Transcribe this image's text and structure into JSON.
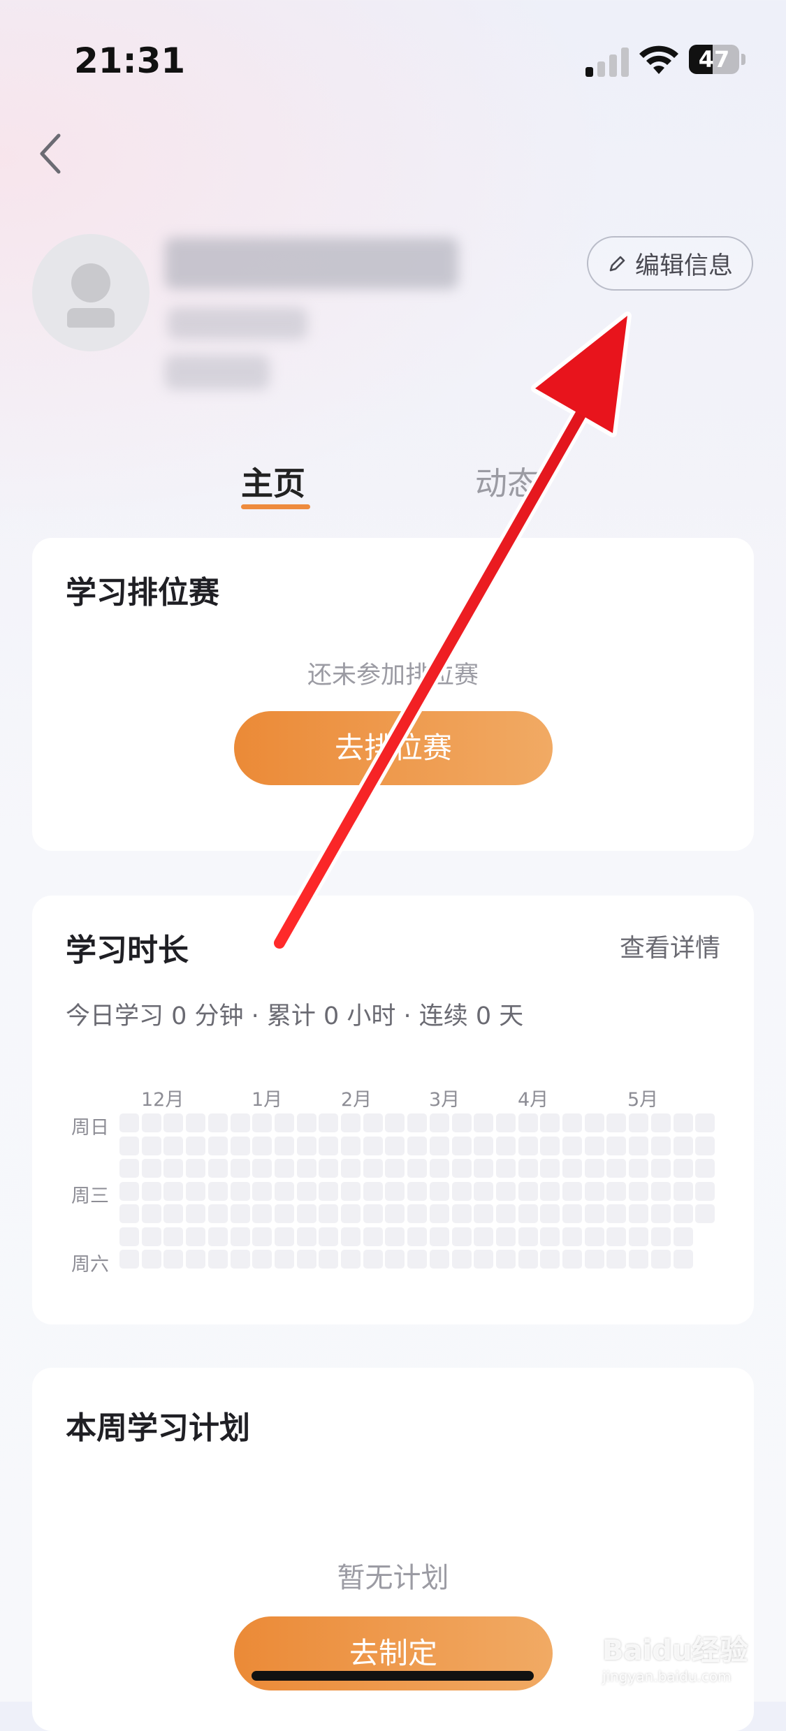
{
  "status_bar": {
    "time": "21:31",
    "battery": "47",
    "battery_level": 0.47
  },
  "profile": {
    "edit_label": "编辑信息"
  },
  "tabs": [
    {
      "label": "主页"
    },
    {
      "label": "动态"
    }
  ],
  "ranking_card": {
    "title": "学习排位赛",
    "empty_text": "还未参加排位赛",
    "button_label": "去排位赛"
  },
  "duration_card": {
    "title": "学习时长",
    "detail_link": "查看详情",
    "summary": "今日学习 0 分钟 · 累计 0 小时 · 连续 0 天",
    "months": [
      "12月",
      "1月",
      "2月",
      "3月",
      "4月",
      "5月"
    ],
    "day_labels": [
      "周日",
      "周三",
      "周六"
    ]
  },
  "plan_card": {
    "title": "本周学习计划",
    "empty_text": "暂无计划",
    "button_label": "去制定"
  },
  "watermark": {
    "brand": "Baidu经验",
    "url": "jingyan.baidu.com"
  },
  "colors": {
    "accent": "#ee8b3d",
    "arrow": "#e8141c"
  }
}
